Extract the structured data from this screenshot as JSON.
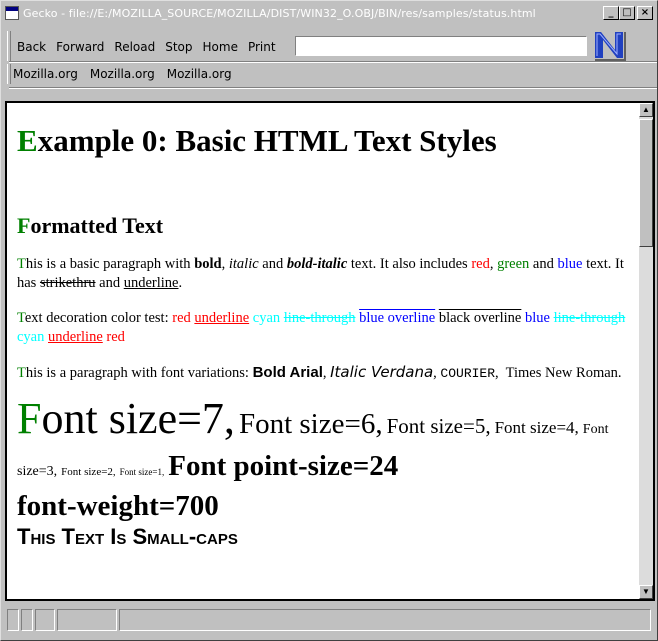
{
  "window": {
    "title": "Gecko - file://E:/MOZILLA_SOURCE/MOZILLA/DIST/WIN32_O.OBJ/BIN/res/samples/status.html",
    "minimize_glyph": "_",
    "maximize_glyph": "□",
    "close_glyph": "×"
  },
  "toolbar": {
    "back": "Back",
    "forward": "Forward",
    "reload": "Reload",
    "stop": "Stop",
    "home": "Home",
    "print": "Print",
    "url_value": ""
  },
  "bookmarks": [
    "Mozilla.org",
    "Mozilla.org",
    "Mozilla.org"
  ],
  "page": {
    "h1_first": "E",
    "h1_rest": "xample 0: Basic HTML Text Styles",
    "h2_first": "F",
    "h2_rest": "ormatted Text",
    "p1": {
      "first": "T",
      "a": "his is a basic paragraph with ",
      "bold": "bold",
      "b": ", ",
      "italic": "italic",
      "c": " and ",
      "bolditalic": "bold-italic",
      "d": " text. It also includes ",
      "red": "red",
      "e": ", ",
      "green": "green",
      "f": " and ",
      "blue": "blue",
      "g": " text. It has ",
      "strike": "strikethru",
      "h": " and ",
      "underline": "underline",
      "i": "."
    },
    "p2": {
      "first": "T",
      "a": "ext decoration color test: ",
      "red": "red",
      "red_underline": "underline",
      "cyan": "cyan",
      "cyan_lt": "line-through",
      "blue_ov": "blue overline",
      "black_ov": "black overline",
      "blue_end": "blue",
      "cyan_lt2": "line-through",
      "cyan2": "cyan",
      "red_underline2": "underline",
      "red2": "red"
    },
    "p3": {
      "first": "T",
      "a": "his is a paragraph with font variations: ",
      "arial": "Bold Arial",
      "verdana": "Italic Verdana",
      "courier": "COURIER",
      "times": "Times New Roman."
    },
    "sizes": {
      "first": "F",
      "s7": "ont size=7,",
      "s6": "Font size=6,",
      "s5": "Font size=5,",
      "s4": "Font size=4,",
      "s3": "Font size=3,",
      "s2": "Font size=2,",
      "s1": "Font size=1,",
      "pt24": "Font point-size=24",
      "fw700": "font-weight=700",
      "smallcaps": "This Text Is Small-caps"
    }
  }
}
